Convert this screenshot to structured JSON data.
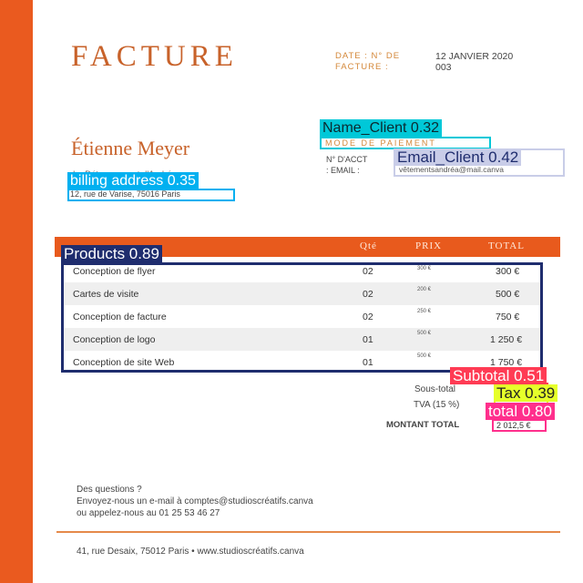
{
  "invoice": {
    "title": "FACTURE",
    "date_label": "DATE : N° DE",
    "invoice_label": "FACTURE :",
    "date_value": "12 JANVIER 2020",
    "number_value": "003"
  },
  "client": {
    "name": "Étienne Meyer",
    "company": "Le Détournement d'Andréa",
    "address": "12, rue de Varise, 75016 Paris"
  },
  "payment": {
    "title": "MODE DE PAIEMENT",
    "acct_label": "N° D'ACCT",
    "email_label": ": EMAIL :",
    "email_value": "vêtementsandréa@mail.canva"
  },
  "table": {
    "headers": {
      "qty": "Qté",
      "price": "PRIX",
      "total": "TOTAL"
    },
    "rows": [
      {
        "name": "Conception de flyer",
        "qty": "02",
        "unit": "300 €",
        "total": "300 €"
      },
      {
        "name": "Cartes de visite",
        "qty": "02",
        "unit": "200 €",
        "total": "500 €"
      },
      {
        "name": "Conception de facture",
        "qty": "02",
        "unit": "250 €",
        "total": "750 €"
      },
      {
        "name": "Conception de logo",
        "qty": "01",
        "unit": "500 €",
        "total": "1 250 €"
      },
      {
        "name": "Conception de site Web",
        "qty": "01",
        "unit": "500 €",
        "total": "1 750 €"
      }
    ]
  },
  "totals": {
    "subtotal_label": "Sous-total",
    "tax_label": "TVA (15 %)",
    "total_label": "MONTANT TOTAL",
    "total_value": "2 012,5 €"
  },
  "contact": {
    "line1": "Des questions ?",
    "line2": "Envoyez-nous un e-mail à comptes@studioscréatifs.canva",
    "line3": "ou appelez-nous au 01 25 53 46 27"
  },
  "footer": "41, rue Desaix, 75012 Paris • www.studioscréatifs.canva",
  "annotations": {
    "name_client": "Name_Client 0.32",
    "email_client": "Email_Client 0.42",
    "billing": "billing address 0.35",
    "products": "Products 0.89",
    "subtotal": "Subtotal 0.51",
    "tax": "Tax 0.39",
    "total": "total 0.80"
  },
  "colors": {
    "accent": "#ea5a1f",
    "cyan": "#00c8d8",
    "sky": "#00b0f0",
    "navy": "#1f2d6e",
    "lavender": "#c9cde8",
    "red": "#ff3b54",
    "yellow": "#e6ff2a",
    "magenta": "#ff2f8c"
  }
}
